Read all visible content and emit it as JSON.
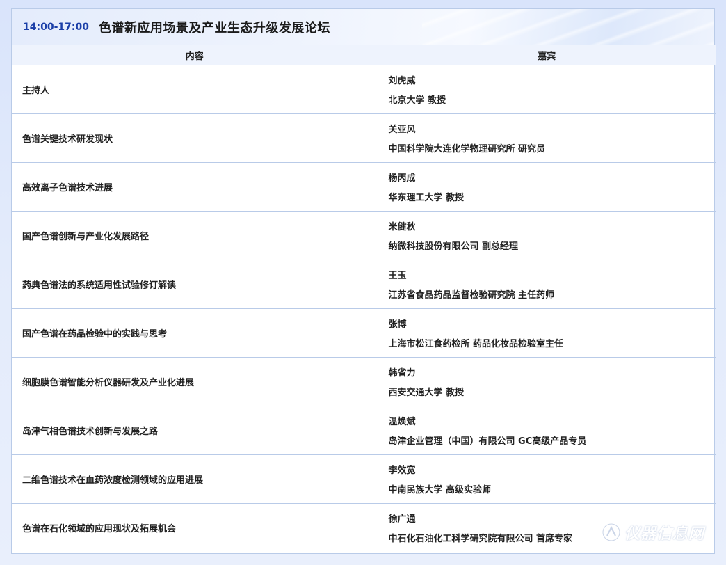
{
  "header": {
    "time": "14:00-17:00",
    "title": "色谱新应用场景及产业生态升级发展论坛"
  },
  "table": {
    "columns": [
      "内容",
      "嘉宾"
    ],
    "rows": [
      {
        "content": "主持人",
        "name": "刘虎威",
        "affiliation": "北京大学 教授"
      },
      {
        "content": "色谱关键技术研发现状",
        "name": "关亚风",
        "affiliation": "中国科学院大连化学物理研究所 研究员"
      },
      {
        "content": "高效离子色谱技术进展",
        "name": "杨丙成",
        "affiliation": "华东理工大学 教授"
      },
      {
        "content": "国产色谱创新与产业化发展路径",
        "name": "米健秋",
        "affiliation": "纳微科技股份有限公司 副总经理"
      },
      {
        "content": "药典色谱法的系统适用性试验修订解读",
        "name": "王玉",
        "affiliation": "江苏省食品药品监督检验研究院 主任药师"
      },
      {
        "content": "国产色谱在药品检验中的实践与思考",
        "name": "张博",
        "affiliation": "上海市松江食药检所 药品化妆品检验室主任"
      },
      {
        "content": "细胞膜色谱智能分析仪器研发及产业化进展",
        "name": "韩省力",
        "affiliation": "西安交通大学 教授"
      },
      {
        "content": "岛津气相色谱技术创新与发展之路",
        "name": "温焕斌",
        "affiliation": "岛津企业管理（中国）有限公司 GC高级产品专员"
      },
      {
        "content": "二维色谱技术在血药浓度检测领域的应用进展",
        "name": "李效宽",
        "affiliation": "中南民族大学 高级实验师"
      },
      {
        "content": "色谱在石化领域的应用现状及拓展机会",
        "name": "徐广通",
        "affiliation": "中石化石油化工科学研究院有限公司 首席专家"
      }
    ]
  },
  "watermark": {
    "text": "仪器信息网",
    "icon": "instrument-logo-icon"
  }
}
